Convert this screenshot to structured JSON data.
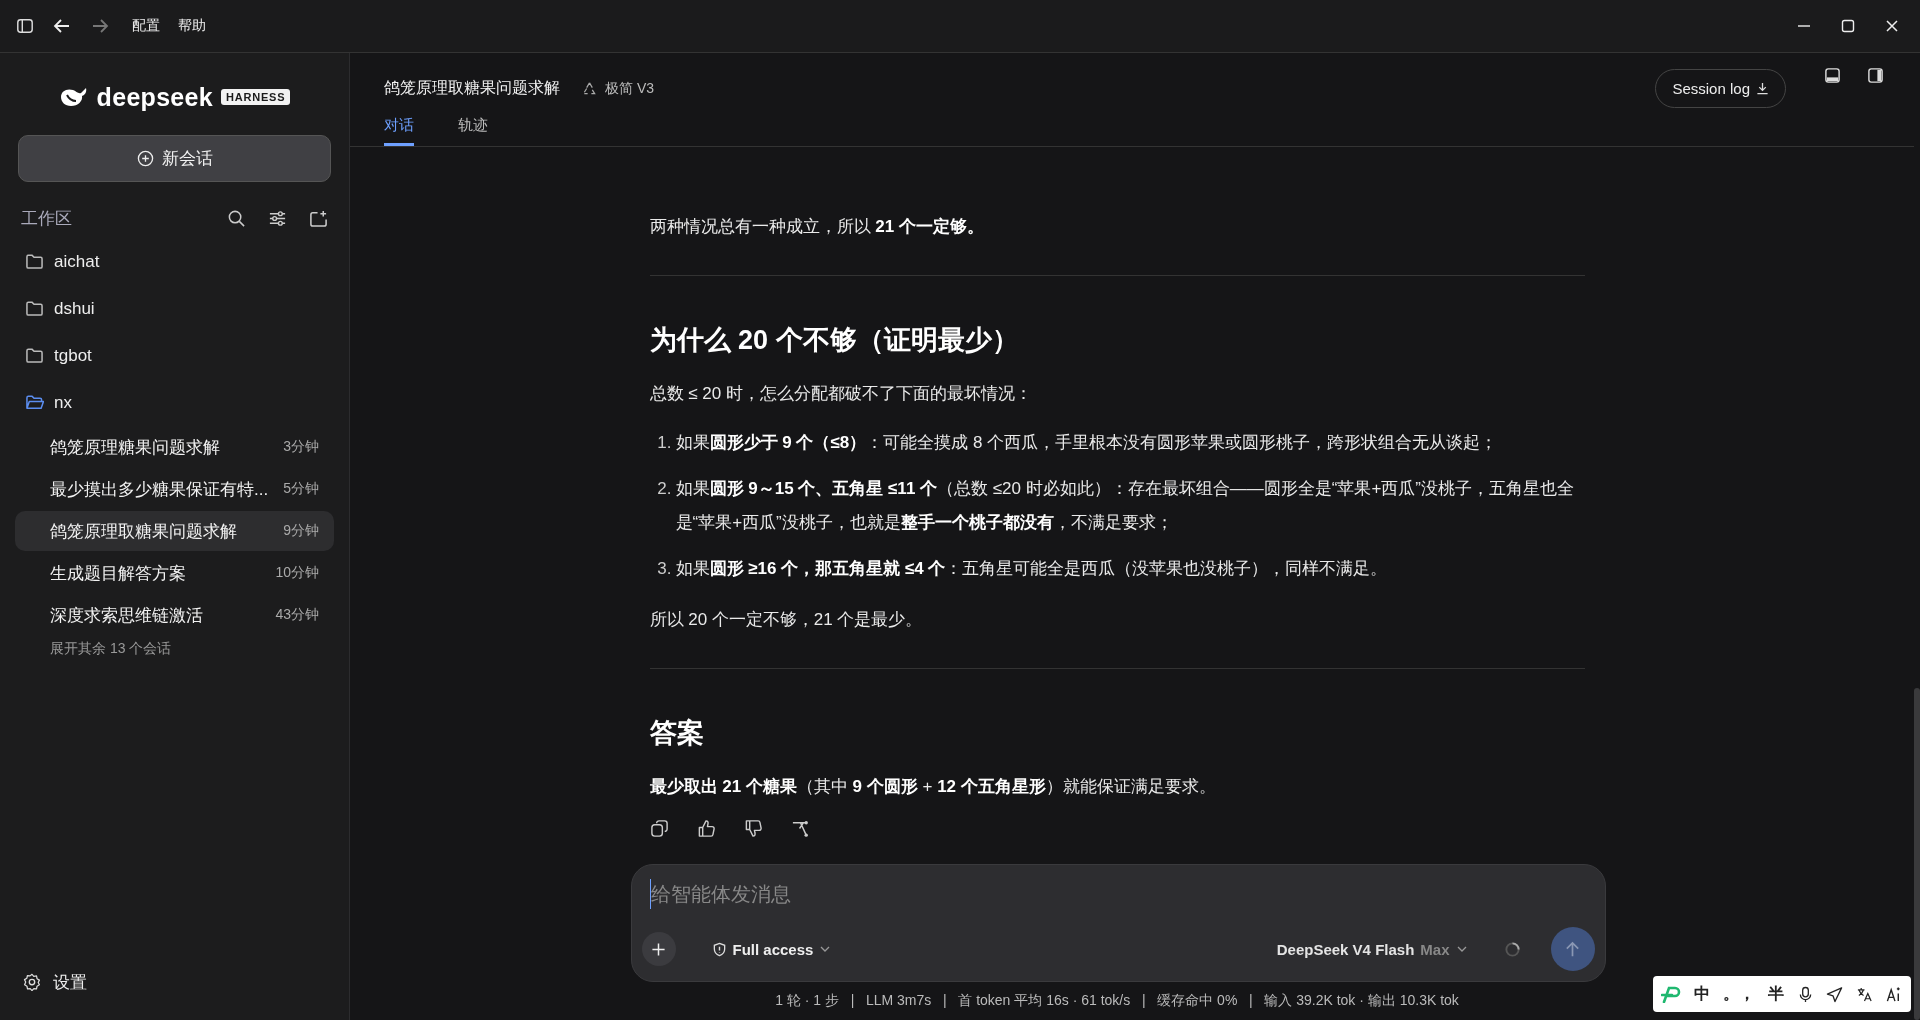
{
  "title_bar": {
    "menu": [
      "配置",
      "帮助"
    ]
  },
  "sidebar": {
    "brand": "deepseek",
    "badge": "HARNESS",
    "new_chat": "新会话",
    "workspace_label": "工作区",
    "folders": [
      {
        "name": "aichat",
        "expanded": false
      },
      {
        "name": "dshui",
        "expanded": false
      },
      {
        "name": "tgbot",
        "expanded": false
      },
      {
        "name": "nx",
        "expanded": true,
        "sessions": [
          {
            "title": "鸽笼原理糖果问题求解",
            "time": "3分钟",
            "selected": false
          },
          {
            "title": "最少摸出多少糖果保证有特...",
            "time": "5分钟",
            "selected": false
          },
          {
            "title": "鸽笼原理取糖果问题求解",
            "time": "9分钟",
            "selected": true
          },
          {
            "title": "生成题目解答方案",
            "time": "10分钟",
            "selected": false
          },
          {
            "title": "深度求索思维链激活",
            "time": "43分钟",
            "selected": false
          }
        ]
      }
    ],
    "expand_more": "展开其余 13 个会话",
    "settings": "设置"
  },
  "header": {
    "title": "鸽笼原理取糖果问题求解",
    "model_badge": "极简 V3",
    "tabs": [
      {
        "label": "对话",
        "selected": true
      },
      {
        "label": "轨迹",
        "selected": false
      }
    ],
    "session_log": "Session log"
  },
  "message": {
    "blocks": [
      {
        "kind": "paragraph",
        "text": "两种情况总有一种成立，所以 **21 个一定够。**"
      },
      {
        "kind": "rule"
      },
      {
        "kind": "heading",
        "text": "为什么 20 个不够（证明最少）"
      },
      {
        "kind": "paragraph",
        "text": "总数 ≤ 20 时，怎么分配都破不了下面的最坏情况："
      },
      {
        "kind": "list",
        "items": [
          {
            "number": "1.",
            "text": "如果**圆形少于 9 个（≤8）**：可能全摸成 8 个西瓜，手里根本没有圆形苹果或圆形桃子，跨形状组合无从谈起；"
          },
          {
            "number": "2.",
            "text": "如果**圆形 9～15 个、五角星 ≤11 个**（总数 ≤20 时必如此）：存在最坏组合——圆形全是“苹果+西瓜”没桃子，五角星也全是“苹果+西瓜”没桃子，也就是**整手一个桃子都没有**，不满足要求；"
          },
          {
            "number": "3.",
            "text": "如果**圆形 ≥16 个，那五角星就 ≤4 个**：五角星可能全是西瓜（没苹果也没桃子），同样不满足。"
          }
        ]
      },
      {
        "kind": "paragraph",
        "text": "所以 20 个一定不够，21 个是最少。"
      },
      {
        "kind": "rule"
      },
      {
        "kind": "heading",
        "text": "答案"
      },
      {
        "kind": "paragraph",
        "text": "**最少取出 21 个糖果**（其中 **9 个圆形** + **12 个五角星形**）就能保证满足要求。"
      }
    ]
  },
  "composer": {
    "placeholder": "给智能体发消息",
    "access": "Full access",
    "model": "DeepSeek V4 Flash",
    "effort": "Max"
  },
  "status_bar": "1 轮 · 1 步   |   LLM 3m7s   |   首 token 平均 16s · 61 tok/s   |   缓存命中 0%   |   输入 39.2K tok · 输出 10.3K tok",
  "ime_bar": {
    "items": [
      "中",
      "。，",
      "半"
    ]
  }
}
